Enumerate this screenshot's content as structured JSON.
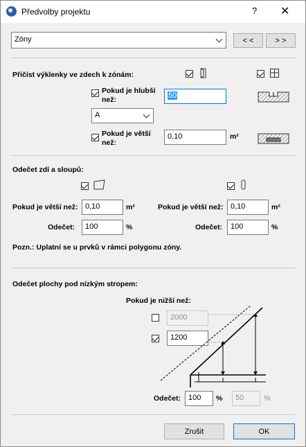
{
  "window": {
    "title": "Předvolby projektu",
    "help_label": "?",
    "close_label": "✕"
  },
  "header": {
    "preset_value": "Zóny",
    "prev_label": "< <",
    "next_label": "> >"
  },
  "niches": {
    "heading": "Přičíst výklenky ve zdech k zónám:",
    "wall_checked": true,
    "window_checked": true,
    "depth_checked": true,
    "depth_label": "Pokud je hlubší než:",
    "depth_value": "50",
    "mode_value": "A",
    "area_checked": true,
    "area_label": "Pokud je větší než:",
    "area_value": "0,10",
    "area_unit": "m²"
  },
  "walls": {
    "heading": "Odečet zdí a sloupů:",
    "wall_checked": true,
    "column_checked": true,
    "left": {
      "larger_label": "Pokud je větší než:",
      "larger_value": "0,10",
      "larger_unit": "m²",
      "deduct_label": "Odečet:",
      "deduct_value": "100",
      "deduct_unit": "%"
    },
    "right": {
      "larger_label": "Pokud je větší než:",
      "larger_value": "0,10",
      "larger_unit": "m²",
      "deduct_label": "Odečet:",
      "deduct_value": "100",
      "deduct_unit": "%"
    },
    "note": "Pozn.: Uplatní se u prvků v rámci polygonu zóny."
  },
  "ceiling": {
    "heading": "Odečet plochy pod nízkým stropem:",
    "lower_label": "Pokud je nižší než:",
    "height1_checked": false,
    "height1_value": "2000",
    "height2_checked": true,
    "height2_value": "1200",
    "deduct_label": "Odečet:",
    "deduct1_value": "100",
    "deduct1_unit": "%",
    "deduct2_value": "50",
    "deduct2_unit": "%"
  },
  "footer": {
    "cancel_label": "Zrušit",
    "ok_label": "OK"
  }
}
